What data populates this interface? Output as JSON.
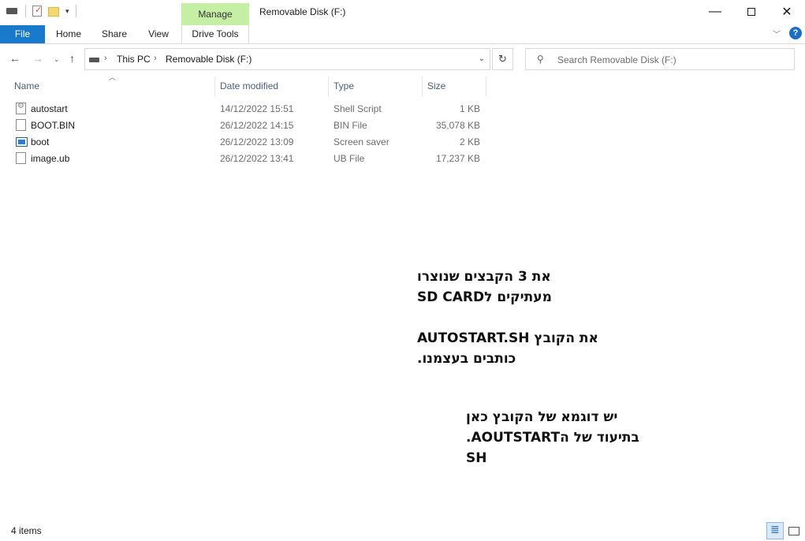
{
  "window": {
    "title": "Removable Disk (F:)",
    "contextual_tab_group": "Manage"
  },
  "ribbon": {
    "tabs": [
      {
        "label": "File"
      },
      {
        "label": "Home"
      },
      {
        "label": "Share"
      },
      {
        "label": "View"
      },
      {
        "label": "Drive Tools"
      }
    ],
    "help_label": "?"
  },
  "address_bar": {
    "breadcrumbs": [
      "This PC",
      "Removable Disk (F:)"
    ]
  },
  "search": {
    "placeholder": "Search Removable Disk (F:)"
  },
  "columns": [
    "Name",
    "Date modified",
    "Type",
    "Size"
  ],
  "files": [
    {
      "name": "autostart",
      "date": "14/12/2022 15:51",
      "type": "Shell Script",
      "size": "1 KB",
      "icon": "script-file-icon"
    },
    {
      "name": "BOOT.BIN",
      "date": "26/12/2022 14:15",
      "type": "BIN File",
      "size": "35,078 KB",
      "icon": "generic-file-icon"
    },
    {
      "name": "boot",
      "date": "26/12/2022 13:09",
      "type": "Screen saver",
      "size": "2 KB",
      "icon": "screensaver-file-icon"
    },
    {
      "name": "image.ub",
      "date": "26/12/2022 13:41",
      "type": "UB File",
      "size": "17,237 KB",
      "icon": "generic-file-icon"
    }
  ],
  "annotations": {
    "note1": [
      "את 3 הקבצים שנוצרו",
      "מעתיקים לSD CARD",
      "",
      "את הקובץ AUTOSTART.SH",
      "כותבים בעצמנו."
    ],
    "note2": [
      "יש דוגמא של הקובץ כאן",
      "בתיעוד של הAOUTSTART.",
      "SH"
    ]
  },
  "status_bar": {
    "item_count": "4 items"
  },
  "colors": {
    "file_tab": "#1979ca",
    "manage_tab": "#c6efa6",
    "header_text": "#4c607a"
  }
}
